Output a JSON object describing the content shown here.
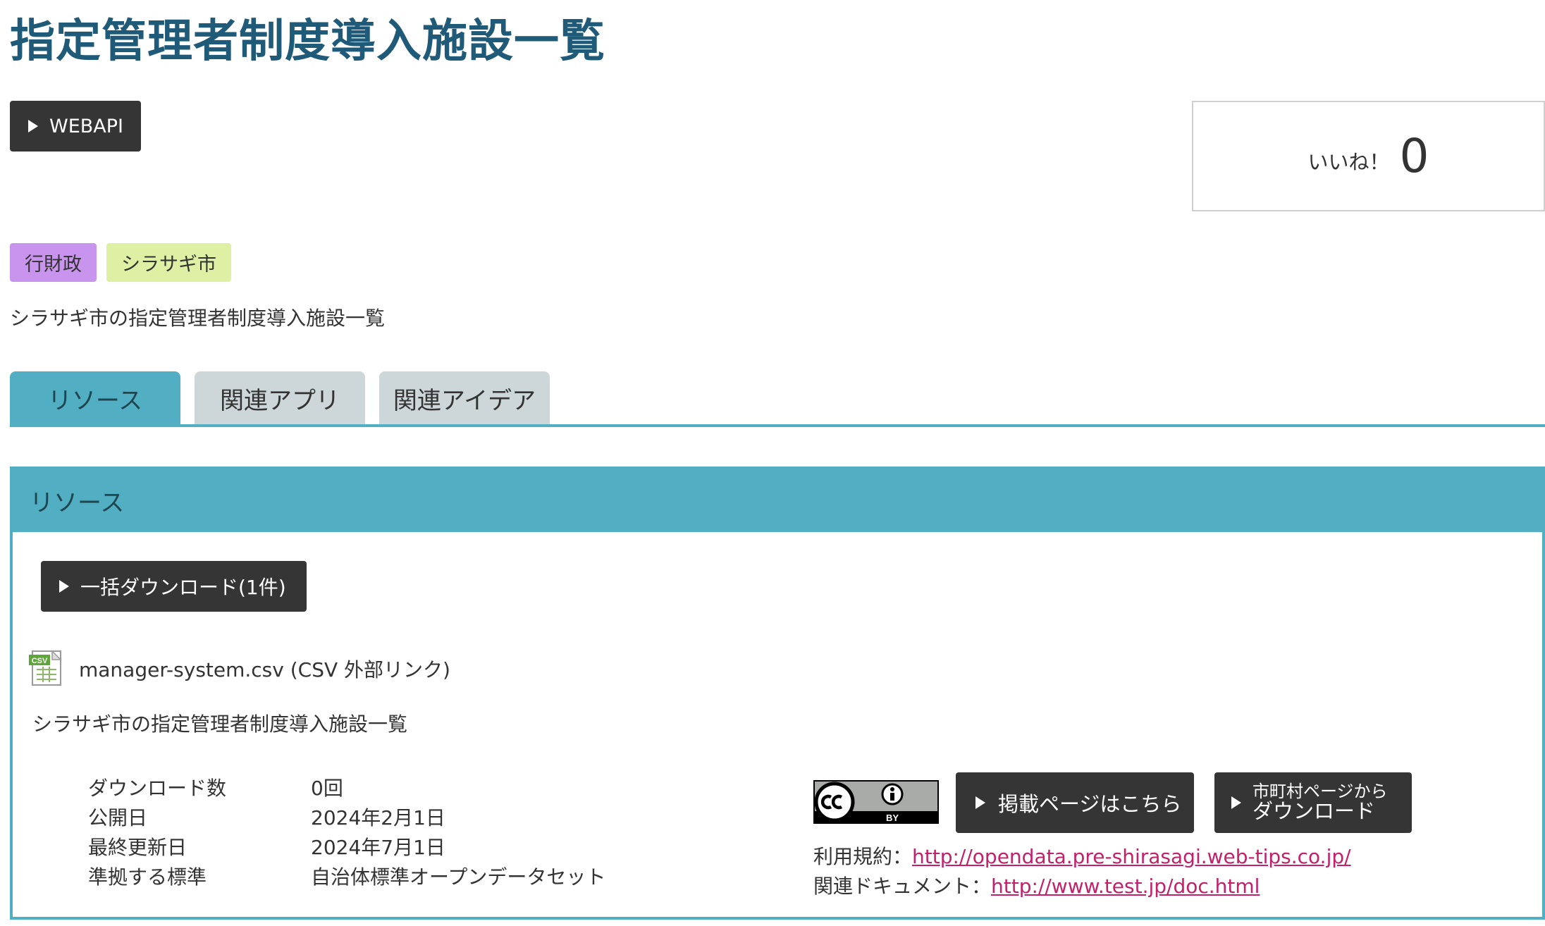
{
  "page": {
    "title": "指定管理者制度導入施設一覧",
    "webapi_label": "WEBAPI",
    "like": {
      "label": "いいね！",
      "count": "0"
    },
    "tags": [
      {
        "label": "行財政",
        "color": "#c994ee"
      },
      {
        "label": "シラサギ市",
        "color": "#ddf0a4"
      }
    ],
    "summary": "シラサギ市の指定管理者制度導入施設一覧"
  },
  "tabs": [
    {
      "label": "リソース",
      "active": true
    },
    {
      "label": "関連アプリ",
      "active": false
    },
    {
      "label": "関連アイデア",
      "active": false
    }
  ],
  "resource": {
    "header": "リソース",
    "bulk_download_label": "一括ダウンロード(1件)",
    "file": {
      "icon": "csv-file-icon",
      "icon_text": "CSV",
      "name": "manager-system.csv (CSV 外部リンク)",
      "description": "シラサギ市の指定管理者制度導入施設一覧"
    },
    "meta": [
      {
        "key": "ダウンロード数",
        "value": "0回"
      },
      {
        "key": "公開日",
        "value": "2024年2月1日"
      },
      {
        "key": "最終更新日",
        "value": "2024年7月1日"
      },
      {
        "key": "準拠する標準",
        "value": "自治体標準オープンデータセット"
      }
    ],
    "license": {
      "icon": "cc-by-icon",
      "badge_text": "BY"
    },
    "publish_page_label": "掲載ページはこちら",
    "city_download": {
      "line1": "市町村ページから",
      "line2": "ダウンロード"
    },
    "terms": {
      "label": "利用規約：",
      "url": "http://opendata.pre-shirasagi.web-tips.co.jp/"
    },
    "related_doc": {
      "label": "関連ドキュメント：",
      "url": "http://www.test.jp/doc.html"
    }
  },
  "colors": {
    "title": "#1f5a78",
    "accent": "#52aec2",
    "button": "#353535",
    "link": "#c4206a",
    "inactive_tab": "#cdd6d8"
  }
}
